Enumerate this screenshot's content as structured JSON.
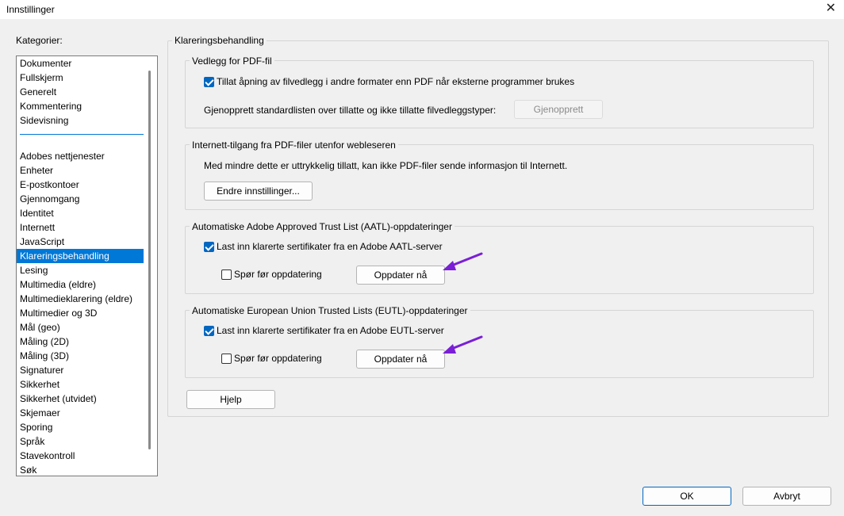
{
  "window": {
    "title": "Innstillinger",
    "close_glyph": "✕"
  },
  "categories": {
    "label": "Kategorier:",
    "group1": [
      "Dokumenter",
      "Fullskjerm",
      "Generelt",
      "Kommentering",
      "Sidevisning"
    ],
    "group2": [
      "Adobes nettjenester",
      "Enheter",
      "E-postkontoer",
      "Gjennomgang",
      "Identitet",
      "Internett",
      "JavaScript",
      "Klareringsbehandling",
      "Lesing",
      "Multimedia (eldre)",
      "Multimedieklarering (eldre)",
      "Multimedier og 3D",
      "Mål (geo)",
      "Måling (2D)",
      "Måling (3D)",
      "Signaturer",
      "Sikkerhet",
      "Sikkerhet (utvidet)",
      "Skjemaer",
      "Sporing",
      "Språk",
      "Stavekontroll",
      "Søk"
    ],
    "selected": "Klareringsbehandling"
  },
  "panel": {
    "title": "Klareringsbehandling",
    "attachments": {
      "title": "Vedlegg for PDF-fil",
      "allow_label": "Tillat åpning av filvedlegg i andre formater enn PDF når eksterne programmer brukes",
      "allow_checked": true,
      "restore_text": "Gjenopprett standardlisten over tillatte og ikke tillatte filvedleggstyper:",
      "restore_button": "Gjenopprett"
    },
    "internet": {
      "title": "Internett-tilgang fra PDF-filer utenfor webleseren",
      "text": "Med mindre dette er uttrykkelig tillatt, kan ikke PDF-filer sende informasjon til Internett.",
      "change_button": "Endre innstillinger..."
    },
    "aatl": {
      "title": "Automatiske Adobe Approved Trust List (AATL)-oppdateringer",
      "load_label": "Last inn klarerte sertifikater fra en Adobe AATL-server",
      "load_checked": true,
      "ask_label": "Spør før oppdatering",
      "ask_checked": false,
      "update_button": "Oppdater nå"
    },
    "eutl": {
      "title": "Automatiske European Union Trusted Lists (EUTL)-oppdateringer",
      "load_label": "Last inn klarerte sertifikater fra en Adobe EUTL-server",
      "load_checked": true,
      "ask_label": "Spør før oppdatering",
      "ask_checked": false,
      "update_button": "Oppdater nå"
    },
    "help_button": "Hjelp"
  },
  "footer": {
    "ok": "OK",
    "cancel": "Avbryt"
  },
  "colors": {
    "accent": "#0078d7",
    "annotation_arrow": "#7a1fd6"
  }
}
